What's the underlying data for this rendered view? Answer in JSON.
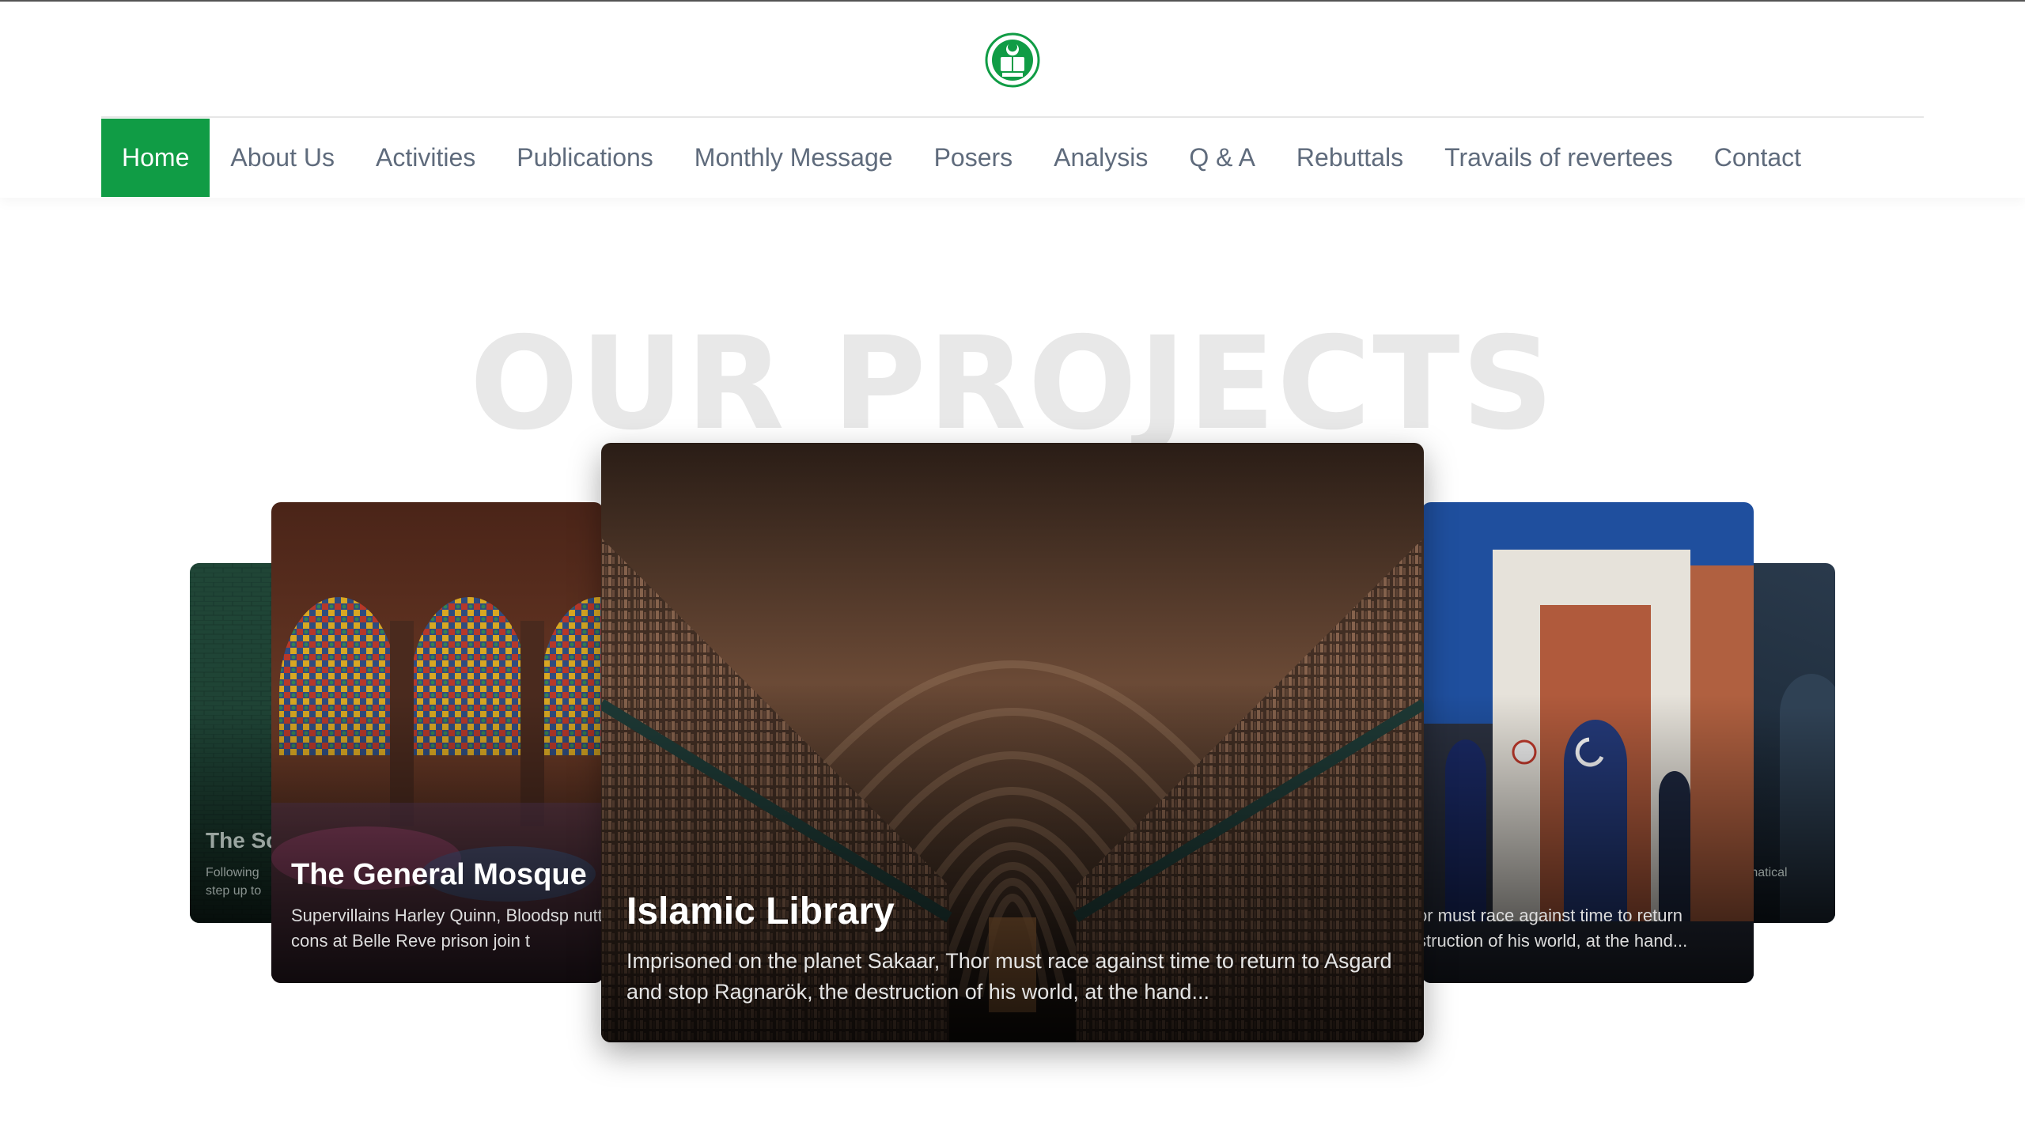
{
  "header": {
    "logo_alt": "organization seal",
    "nav": [
      {
        "label": "Home",
        "active": true
      },
      {
        "label": "About Us"
      },
      {
        "label": "Activities"
      },
      {
        "label": "Publications"
      },
      {
        "label": "Monthly Message"
      },
      {
        "label": "Posers"
      },
      {
        "label": "Analysis"
      },
      {
        "label": "Q & A"
      },
      {
        "label": "Rebuttals"
      },
      {
        "label": "Travails of revertees"
      },
      {
        "label": "Contact"
      }
    ]
  },
  "section": {
    "title": "OUR PROJECTS"
  },
  "carousel": {
    "far_left": {
      "title": "The Sc",
      "desc": "Following step up to"
    },
    "left": {
      "title": "The General Mosque",
      "desc": "Supervillains Harley Quinn, Bloodsp nutty cons at Belle Reve prison join t"
    },
    "center": {
      "title": "Islamic Library",
      "desc": "Imprisoned on the planet Sakaar, Thor must race against time to return to Asgard and stop Ragnarök, the destruction of his world, at the hand..."
    },
    "right": {
      "desc": "or must race against time to return struction of his world, at the hand..."
    },
    "far_right": {
      "desc": "fanatical"
    }
  },
  "colors": {
    "accent": "#109c45",
    "nav_text": "#5f6b7c",
    "title_ghost": "#e8e8e8"
  }
}
